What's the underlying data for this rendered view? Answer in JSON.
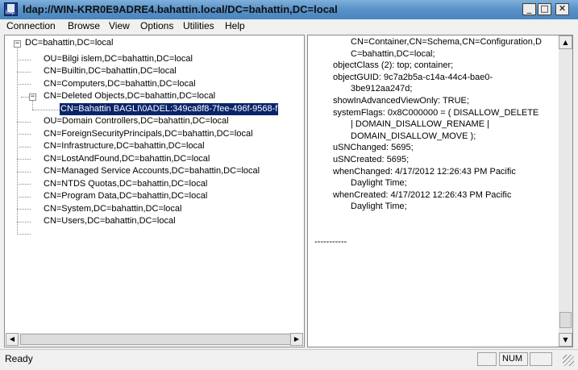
{
  "window": {
    "title": "ldap://WIN-KRR0E9ADRE4.bahattin.local/DC=bahattin,DC=local",
    "icon_label": "ldap",
    "controls": {
      "minimize": "_",
      "maximize": "□",
      "close": "✕"
    }
  },
  "menu": [
    "Connection",
    "Browse",
    "View",
    "Options",
    "Utilities",
    "Help"
  ],
  "tree": {
    "root": {
      "label": "DC=bahattin,DC=local",
      "expander": "−"
    },
    "children": [
      {
        "label": "OU=Bilgi islem,DC=bahattin,DC=local"
      },
      {
        "label": "CN=Builtin,DC=bahattin,DC=local"
      },
      {
        "label": "CN=Computers,DC=bahattin,DC=local"
      },
      {
        "label": "CN=Deleted Objects,DC=bahattin,DC=local",
        "expander": "−"
      },
      {
        "label": "CN=Bahattin BAGLI\\0ADEL:349ca8f8-7fee-496f-9568-f"
      },
      {
        "label": "OU=Domain Controllers,DC=bahattin,DC=local"
      },
      {
        "label": "CN=ForeignSecurityPrincipals,DC=bahattin,DC=local"
      },
      {
        "label": "CN=Infrastructure,DC=bahattin,DC=local"
      },
      {
        "label": "CN=LostAndFound,DC=bahattin,DC=local"
      },
      {
        "label": "CN=Managed Service Accounts,DC=bahattin,DC=local"
      },
      {
        "label": "CN=NTDS Quotas,DC=bahattin,DC=local"
      },
      {
        "label": "CN=Program Data,DC=bahattin,DC=local"
      },
      {
        "label": "CN=System,DC=bahattin,DC=local"
      },
      {
        "label": "CN=Users,DC=bahattin,DC=local"
      }
    ]
  },
  "details": {
    "lines": [
      "CN=Container,CN=Schema,CN=Configuration,D",
      "C=bahattin,DC=local;",
      "objectClass (2): top; container;",
      "objectGUID: 9c7a2b5a-c14a-44c4-bae0-",
      "3be912aa247d;",
      "showInAdvancedViewOnly: TRUE;",
      "systemFlags: 0x8C000000 = ( DISALLOW_DELETE",
      "| DOMAIN_DISALLOW_RENAME |",
      "DOMAIN_DISALLOW_MOVE );",
      "uSNChanged: 5695;",
      "uSNCreated: 5695;",
      "whenChanged: 4/17/2012 12:26:43 PM Pacific",
      "Daylight Time;",
      "whenCreated: 4/17/2012 12:26:43 PM Pacific",
      "Daylight Time;",
      "",
      "",
      "-----------"
    ]
  },
  "scrollbars": {
    "left_arrow": "◀",
    "right_arrow": "▶",
    "up_arrow": "▲",
    "down_arrow": "▼"
  },
  "status": {
    "text": "Ready",
    "panels": [
      "",
      "NUM",
      ""
    ]
  },
  "colors": {
    "title_bar": "#5a93c9",
    "selection": "#0a246a",
    "chrome": "#f0f0f0"
  }
}
